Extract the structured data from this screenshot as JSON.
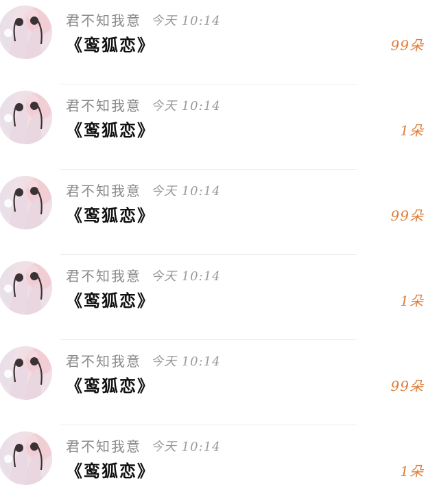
{
  "messages": [
    {
      "user": "君不知我意",
      "time": "今天 10:14",
      "title": "《鸾狐恋》",
      "gift": "99朵"
    },
    {
      "user": "君不知我意",
      "time": "今天 10:14",
      "title": "《鸾狐恋》",
      "gift": "1朵"
    },
    {
      "user": "君不知我意",
      "time": "今天 10:14",
      "title": "《鸾狐恋》",
      "gift": "99朵"
    },
    {
      "user": "君不知我意",
      "time": "今天 10:14",
      "title": "《鸾狐恋》",
      "gift": "1朵"
    },
    {
      "user": "君不知我意",
      "time": "今天 10:14",
      "title": "《鸾狐恋》",
      "gift": "99朵"
    },
    {
      "user": "君不知我意",
      "time": "今天 10:14",
      "title": "《鸾狐恋》",
      "gift": "1朵"
    }
  ],
  "colors": {
    "gift": "#e07e3a",
    "username": "#8a8a8a",
    "title": "#111111"
  },
  "icons": {
    "avatar": "avatar-illustration"
  }
}
